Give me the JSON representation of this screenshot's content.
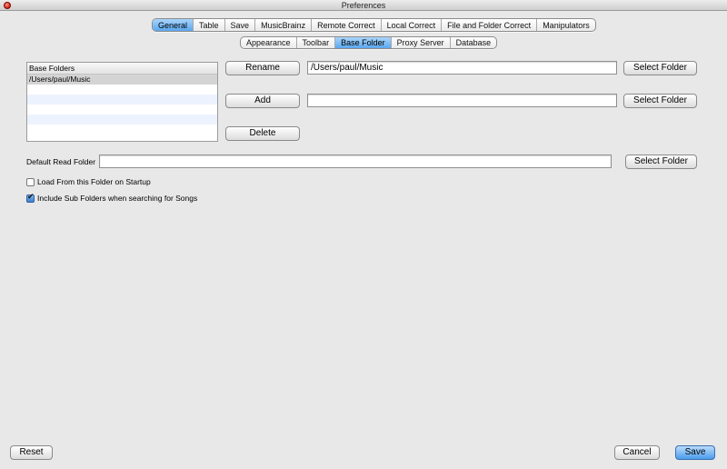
{
  "window": {
    "title": "Preferences"
  },
  "main_tabs": [
    {
      "label": "General",
      "active": true
    },
    {
      "label": "Table",
      "active": false
    },
    {
      "label": "Save",
      "active": false
    },
    {
      "label": "MusicBrainz",
      "active": false
    },
    {
      "label": "Remote Correct",
      "active": false
    },
    {
      "label": "Local Correct",
      "active": false
    },
    {
      "label": "File and Folder Correct",
      "active": false
    },
    {
      "label": "Manipulators",
      "active": false
    }
  ],
  "sub_tabs": [
    {
      "label": "Appearance",
      "active": false
    },
    {
      "label": "Toolbar",
      "active": false
    },
    {
      "label": "Base Folder",
      "active": true
    },
    {
      "label": "Proxy Server",
      "active": false
    },
    {
      "label": "Database",
      "active": false
    }
  ],
  "base_folders": {
    "header": "Base Folders",
    "items": [
      "/Users/paul/Music"
    ]
  },
  "buttons": {
    "rename": "Rename",
    "add": "Add",
    "delete": "Delete",
    "select_folder": "Select Folder",
    "reset": "Reset",
    "cancel": "Cancel",
    "save": "Save"
  },
  "fields": {
    "rename_value": "/Users/paul/Music",
    "add_value": "",
    "default_read_folder_value": ""
  },
  "default_read_folder_label": "Default Read Folder",
  "checkboxes": {
    "load_from_folder": {
      "label": "Load From this Folder on Startup",
      "checked": false
    },
    "include_sub_folders": {
      "label": "Include Sub Folders when searching for Songs",
      "checked": true
    }
  },
  "colors": {
    "accent": "#5aa7ef",
    "close_button": "#d21f12"
  }
}
